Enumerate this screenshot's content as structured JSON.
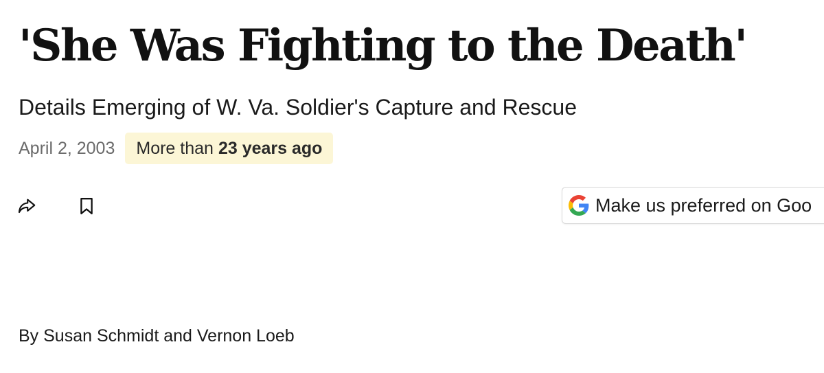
{
  "article": {
    "headline": "'She Was Fighting to the Death'",
    "subheadline": "Details Emerging of W. Va. Soldier's Capture and Rescue",
    "date": "April 2, 2003",
    "age_badge": {
      "prefix": "More than",
      "emphasis": "23 years ago",
      "background_color": "#fcf6d6"
    },
    "byline": "By Susan Schmidt and Vernon Loeb"
  },
  "actions": {
    "share_icon": "share-arrow-icon",
    "save_icon": "bookmark-icon",
    "google_button": {
      "label": "Make us preferred on Goo",
      "icon": "google-g-icon"
    }
  }
}
